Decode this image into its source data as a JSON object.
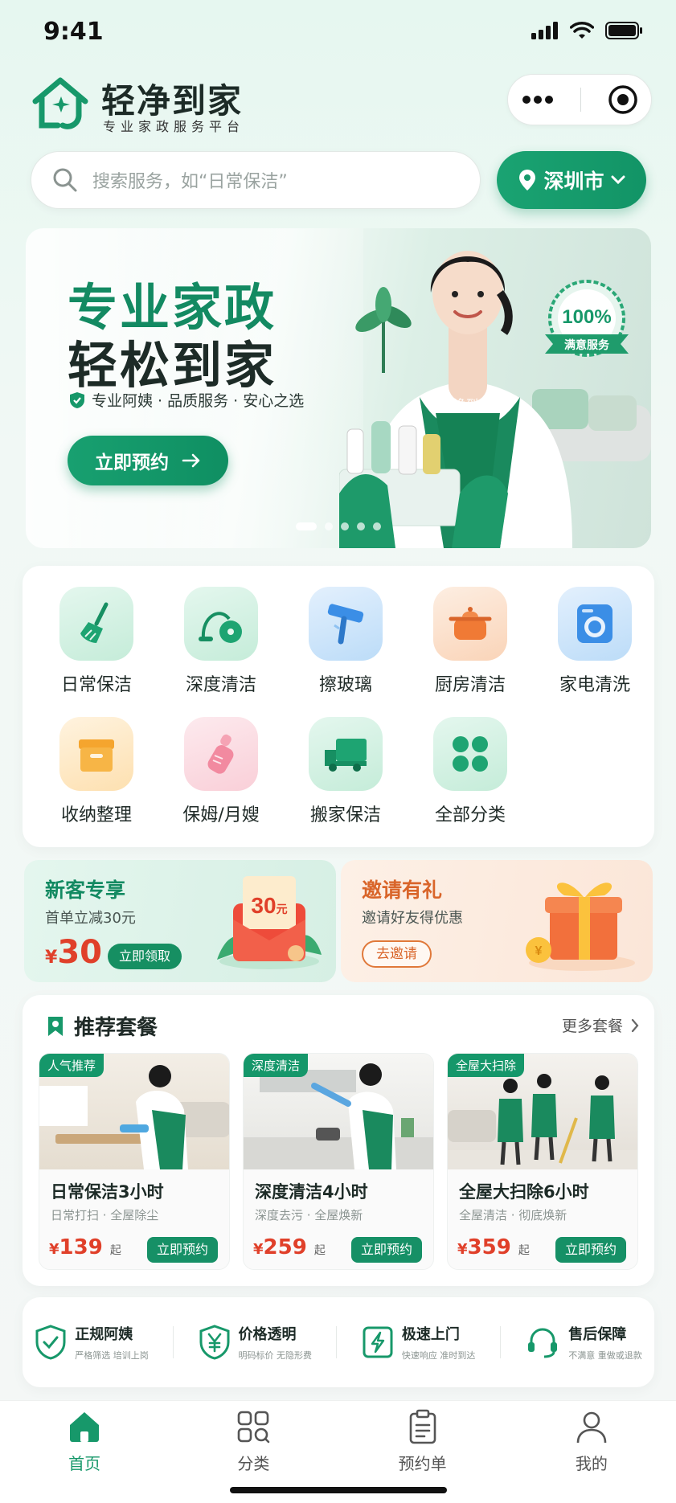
{
  "status_bar": {
    "time": "9:41"
  },
  "header": {
    "brand_name": "轻净到家",
    "brand_subtitle": "专业家政服务平台"
  },
  "search": {
    "placeholder": "搜索服务，如“日常保洁”",
    "city": "深圳市"
  },
  "banner": {
    "title_line1": "专业家政",
    "title_line2": "轻松到家",
    "subtitle": "专业阿姨 · 品质服务 · 安心之选",
    "button_label": "立即预约",
    "badge_percent": "100%",
    "badge_label": "满意服务",
    "apron_text": "轻净到家"
  },
  "categories": [
    {
      "label": "日常保洁",
      "icon": "broom-icon"
    },
    {
      "label": "深度清洁",
      "icon": "vacuum-icon"
    },
    {
      "label": "擦玻璃",
      "icon": "squeegee-icon"
    },
    {
      "label": "厨房清洁",
      "icon": "pot-icon"
    },
    {
      "label": "家电清洗",
      "icon": "washing-machine-icon"
    },
    {
      "label": "收纳整理",
      "icon": "storage-box-icon"
    },
    {
      "label": "保姆/月嫂",
      "icon": "baby-bottle-icon"
    },
    {
      "label": "搬家保洁",
      "icon": "truck-icon"
    },
    {
      "label": "全部分类",
      "icon": "grid-icon"
    }
  ],
  "promos": {
    "new_user": {
      "title": "新客专享",
      "subtitle": "首单立减30元",
      "currency": "¥",
      "amount": "30",
      "button_label": "立即领取",
      "coupon_amount": "30",
      "coupon_unit": "元"
    },
    "invite": {
      "title": "邀请有礼",
      "subtitle": "邀请好友得优惠",
      "button_label": "去邀请"
    }
  },
  "packages": {
    "title": "推荐套餐",
    "more_label": "更多套餐",
    "items": [
      {
        "tag": "人气推荐",
        "name": "日常保洁3小时",
        "desc": "日常打扫 · 全屋除尘",
        "currency": "¥",
        "price": "139",
        "unit": "起",
        "button_label": "立即预约"
      },
      {
        "tag": "深度清洁",
        "name": "深度清洁4小时",
        "desc": "深度去污 · 全屋焕新",
        "currency": "¥",
        "price": "259",
        "unit": "起",
        "button_label": "立即预约"
      },
      {
        "tag": "全屋大扫除",
        "name": "全屋大扫除6小时",
        "desc": "全屋清洁 · 彻底焕新",
        "currency": "¥",
        "price": "359",
        "unit": "起",
        "button_label": "立即预约"
      }
    ]
  },
  "guarantees": [
    {
      "title": "正规阿姨",
      "subtitle": "严格筛选 培训上岗",
      "icon": "shield-check-icon"
    },
    {
      "title": "价格透明",
      "subtitle": "明码标价 无隐形费",
      "icon": "yen-shield-icon"
    },
    {
      "title": "极速上门",
      "subtitle": "快速响应 准时到达",
      "icon": "lightning-icon"
    },
    {
      "title": "售后保障",
      "subtitle": "不满意 重做或退款",
      "icon": "headset-icon"
    }
  ],
  "tabs": [
    {
      "label": "首页",
      "icon": "home-icon",
      "active": true
    },
    {
      "label": "分类",
      "icon": "category-icon",
      "active": false
    },
    {
      "label": "预约单",
      "icon": "clipboard-icon",
      "active": false
    },
    {
      "label": "我的",
      "icon": "user-icon",
      "active": false
    }
  ],
  "colors": {
    "brand": "#17986a",
    "price": "#e0402a",
    "invite": "#d9652a"
  }
}
